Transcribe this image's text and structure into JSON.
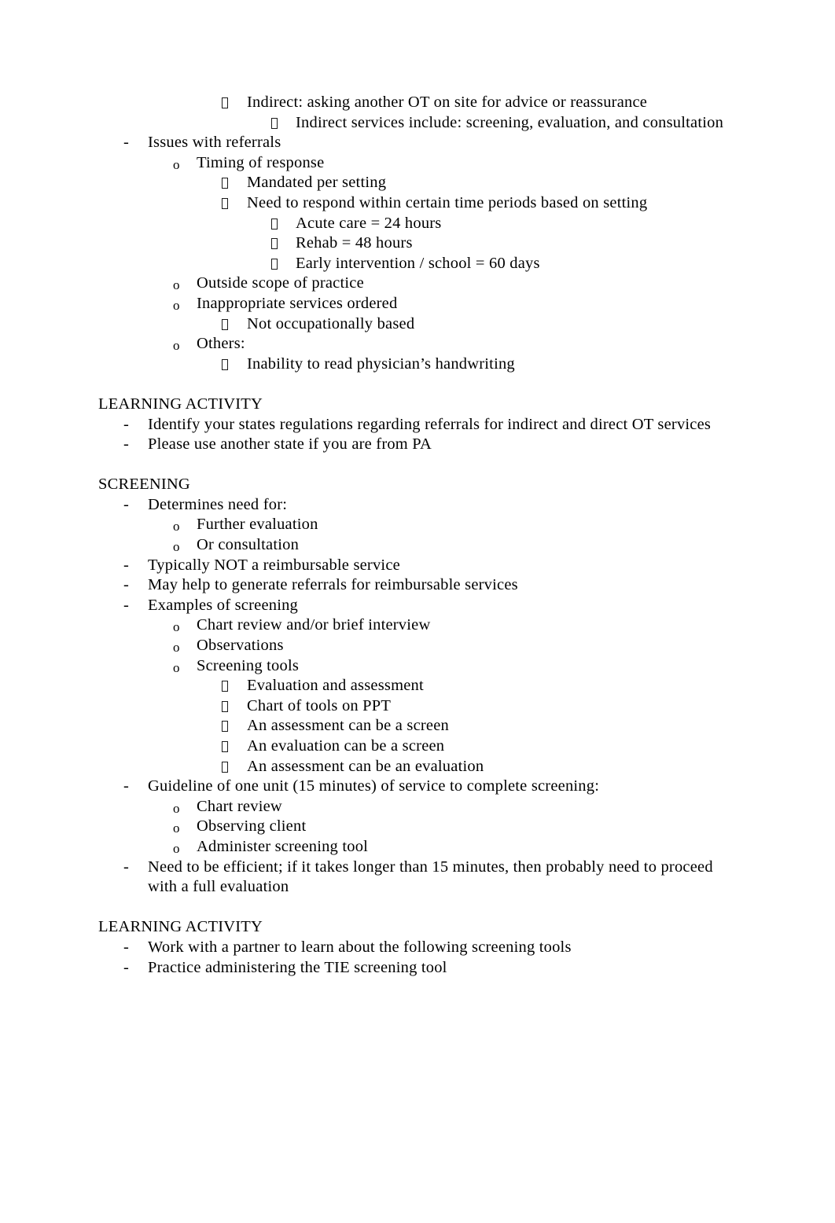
{
  "document": {
    "type": "outline-notes",
    "font_color": "#000000",
    "background": "#ffffff",
    "markers": {
      "level1": "-",
      "level2": "o",
      "level3": "box-glyph",
      "level4": "box-glyph"
    },
    "lines": [
      {
        "level": 3,
        "text": "Indirect: asking another OT on site for advice or reassurance"
      },
      {
        "level": 4,
        "text": "Indirect services include: screening, evaluation, and consultation"
      },
      {
        "level": 1,
        "text": "Issues with referrals"
      },
      {
        "level": 2,
        "text": "Timing of response"
      },
      {
        "level": 3,
        "text": "Mandated per setting"
      },
      {
        "level": 3,
        "text": "Need to respond within certain time periods based on setting"
      },
      {
        "level": 4,
        "text": "Acute care = 24 hours"
      },
      {
        "level": 4,
        "text": "Rehab = 48 hours"
      },
      {
        "level": 4,
        "text": "Early intervention / school = 60 days"
      },
      {
        "level": 2,
        "text": "Outside scope of practice"
      },
      {
        "level": 2,
        "text": "Inappropriate services ordered"
      },
      {
        "level": 3,
        "text": "Not occupationally based"
      },
      {
        "level": 2,
        "text": "Others:"
      },
      {
        "level": 3,
        "text": "Inability to read physician’s handwriting"
      },
      {
        "level": 0,
        "text": ""
      },
      {
        "level": -1,
        "text": "LEARNING ACTIVITY"
      },
      {
        "level": 1,
        "text": "Identify your states regulations regarding referrals for indirect and direct OT services"
      },
      {
        "level": 1,
        "text": "Please use another state if you are from PA"
      },
      {
        "level": 0,
        "text": ""
      },
      {
        "level": -1,
        "text": "SCREENING"
      },
      {
        "level": 1,
        "text": "Determines need for:"
      },
      {
        "level": 2,
        "text": "Further evaluation"
      },
      {
        "level": 2,
        "text": "Or consultation"
      },
      {
        "level": 1,
        "text": "Typically NOT a reimbursable service"
      },
      {
        "level": 1,
        "text": "May help to generate referrals for reimbursable services"
      },
      {
        "level": 1,
        "text": "Examples of screening"
      },
      {
        "level": 2,
        "text": "Chart review and/or brief interview"
      },
      {
        "level": 2,
        "text": "Observations"
      },
      {
        "level": 2,
        "text": "Screening tools"
      },
      {
        "level": 3,
        "text": "Evaluation and assessment"
      },
      {
        "level": 3,
        "text": "Chart of tools on PPT"
      },
      {
        "level": 3,
        "text": "An assessment can be a screen"
      },
      {
        "level": 3,
        "text": "An evaluation can be a screen"
      },
      {
        "level": 3,
        "text": "An assessment can be an evaluation"
      },
      {
        "level": 1,
        "text": "Guideline of one unit (15 minutes) of service to complete screening:"
      },
      {
        "level": 2,
        "text": "Chart review"
      },
      {
        "level": 2,
        "text": "Observing client"
      },
      {
        "level": 2,
        "text": "Administer screening tool"
      },
      {
        "level": 1,
        "text": "Need to be efficient; if it takes longer than 15 minutes, then probably need to proceed with a full evaluation"
      },
      {
        "level": 0,
        "text": ""
      },
      {
        "level": -1,
        "text": "LEARNING ACTIVITY"
      },
      {
        "level": 1,
        "text": "Work with a partner to learn about the following screening tools"
      },
      {
        "level": 1,
        "text": "Practice administering the TIE screening tool"
      }
    ]
  }
}
